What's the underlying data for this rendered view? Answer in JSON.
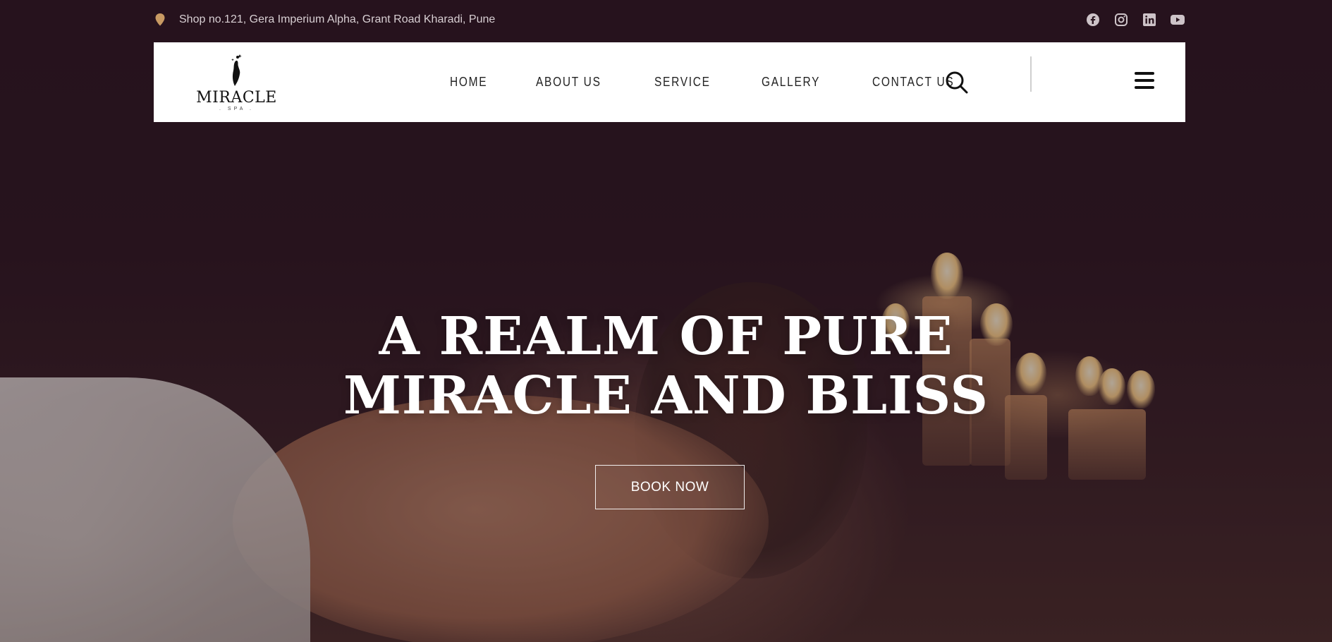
{
  "topbar": {
    "address": "Shop no.121, Gera Imperium Alpha, Grant Road Kharadi, Pune",
    "pin_icon": "location-pin-icon",
    "socials": [
      {
        "name": "facebook-icon"
      },
      {
        "name": "instagram-icon"
      },
      {
        "name": "linkedin-icon"
      },
      {
        "name": "youtube-icon"
      }
    ]
  },
  "header": {
    "logo_text": "MIRACLE",
    "logo_sub": ". SPA .",
    "nav": [
      {
        "label": "HOME"
      },
      {
        "label": "ABOUT US"
      },
      {
        "label": "SERVICE"
      },
      {
        "label": "GALLERY"
      },
      {
        "label": "CONTACT US"
      }
    ],
    "search_icon": "search-icon",
    "menu_icon": "hamburger-menu-icon"
  },
  "hero": {
    "headline_line1": "A REALM OF PURE",
    "headline_line2": "MIRACLE AND BLISS",
    "cta_label": "BOOK NOW"
  },
  "colors": {
    "accent": "#c89a63",
    "header_bg": "#ffffff",
    "hero_overlay": "#2a1620",
    "text_light": "#ffffff"
  }
}
